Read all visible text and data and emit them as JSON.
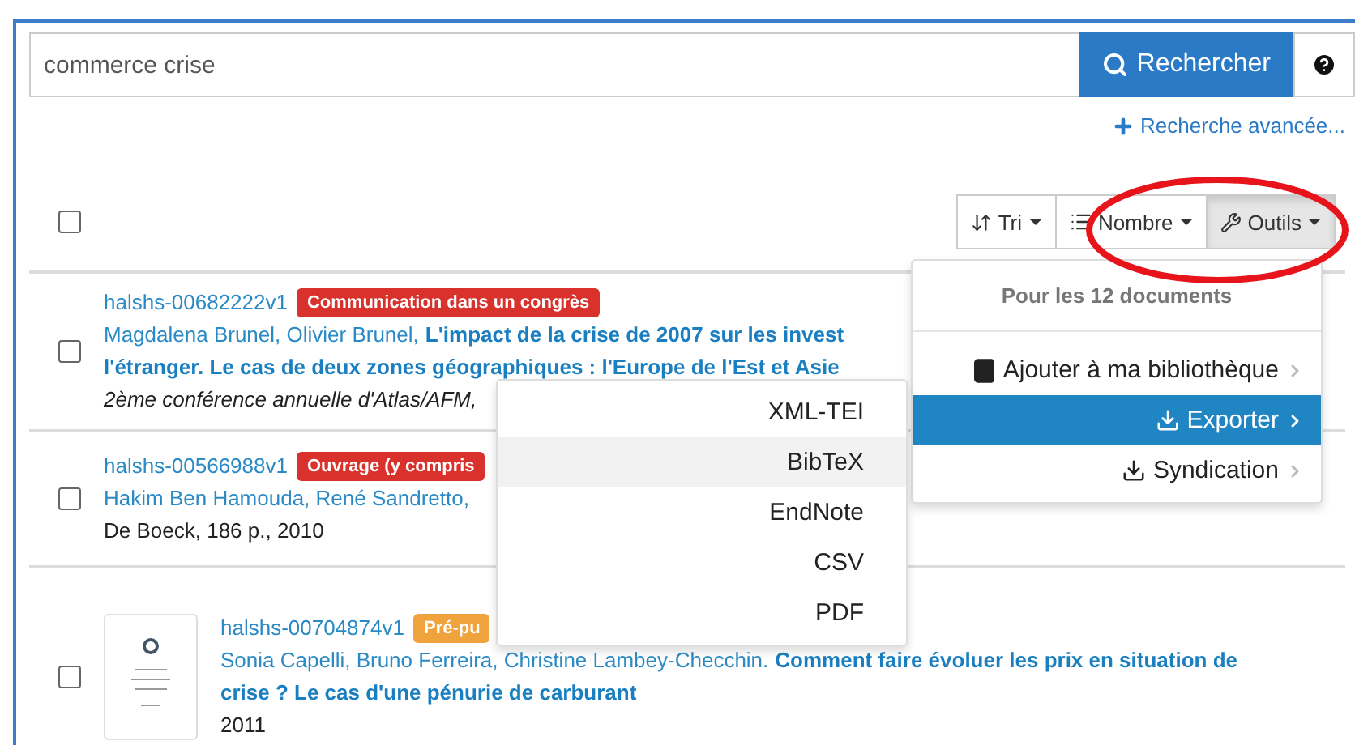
{
  "search": {
    "value": "commerce crise",
    "button": "Rechercher"
  },
  "advanced_link": "Recherche avancée...",
  "select_all": {
    "checked": false
  },
  "toolbar": [
    {
      "label": "Tri",
      "kind": "sort",
      "selected": false
    },
    {
      "label": "Nombre",
      "kind": "list",
      "selected": false
    },
    {
      "label": "Outils",
      "kind": "tools",
      "selected": true
    }
  ],
  "tools_menu": {
    "header": "Pour les 12 documents",
    "items": [
      {
        "label": "Ajouter à ma bibliothèque",
        "kind": "library",
        "selected": false
      },
      {
        "label": "Exporter",
        "kind": "export",
        "selected": true
      },
      {
        "label": "Syndication",
        "kind": "export",
        "selected": false
      }
    ]
  },
  "export_menu": {
    "items": [
      {
        "label": "XML-TEI",
        "selected": false
      },
      {
        "label": "BibTeX",
        "selected": true
      },
      {
        "label": "EndNote",
        "selected": false
      },
      {
        "label": "CSV",
        "selected": false
      },
      {
        "label": "PDF",
        "selected": false
      }
    ]
  },
  "results": [
    {
      "checked": false,
      "thumbnail": false,
      "id": "halshs-00682222v1",
      "type": "Communication dans un congrès",
      "color": "#d9312c",
      "authors": "Magdalena Brunel, Olivier Brunel,",
      "title": [
        "L'impact de la crise de 2007 sur les invest",
        "l'étranger. Le cas de deux zones géographiques : l'Europe de l'Est et Asie"
      ],
      "source": "2ème conférence annuelle d'Atlas/AFM,"
    },
    {
      "checked": false,
      "thumbnail": false,
      "id": "halshs-00566988v1",
      "type": "Ouvrage (y compris",
      "color": "#d9312c",
      "authors": "Hakim Ben Hamouda, René Sandretto,",
      "source": "De Boeck, 186 p., 2010"
    },
    {
      "checked": false,
      "thumbnail": true,
      "id": "halshs-00704874v1",
      "type": "Pré-pu",
      "color": "#f0a23c",
      "authors": "Sonia Capelli, Bruno Ferreira, Christine Lambey-Checchin.",
      "title": [
        "Comment faire évoluer les prix en situation de",
        "crise ? Le cas d'une pénurie de carburant"
      ],
      "source": "2011"
    }
  ]
}
